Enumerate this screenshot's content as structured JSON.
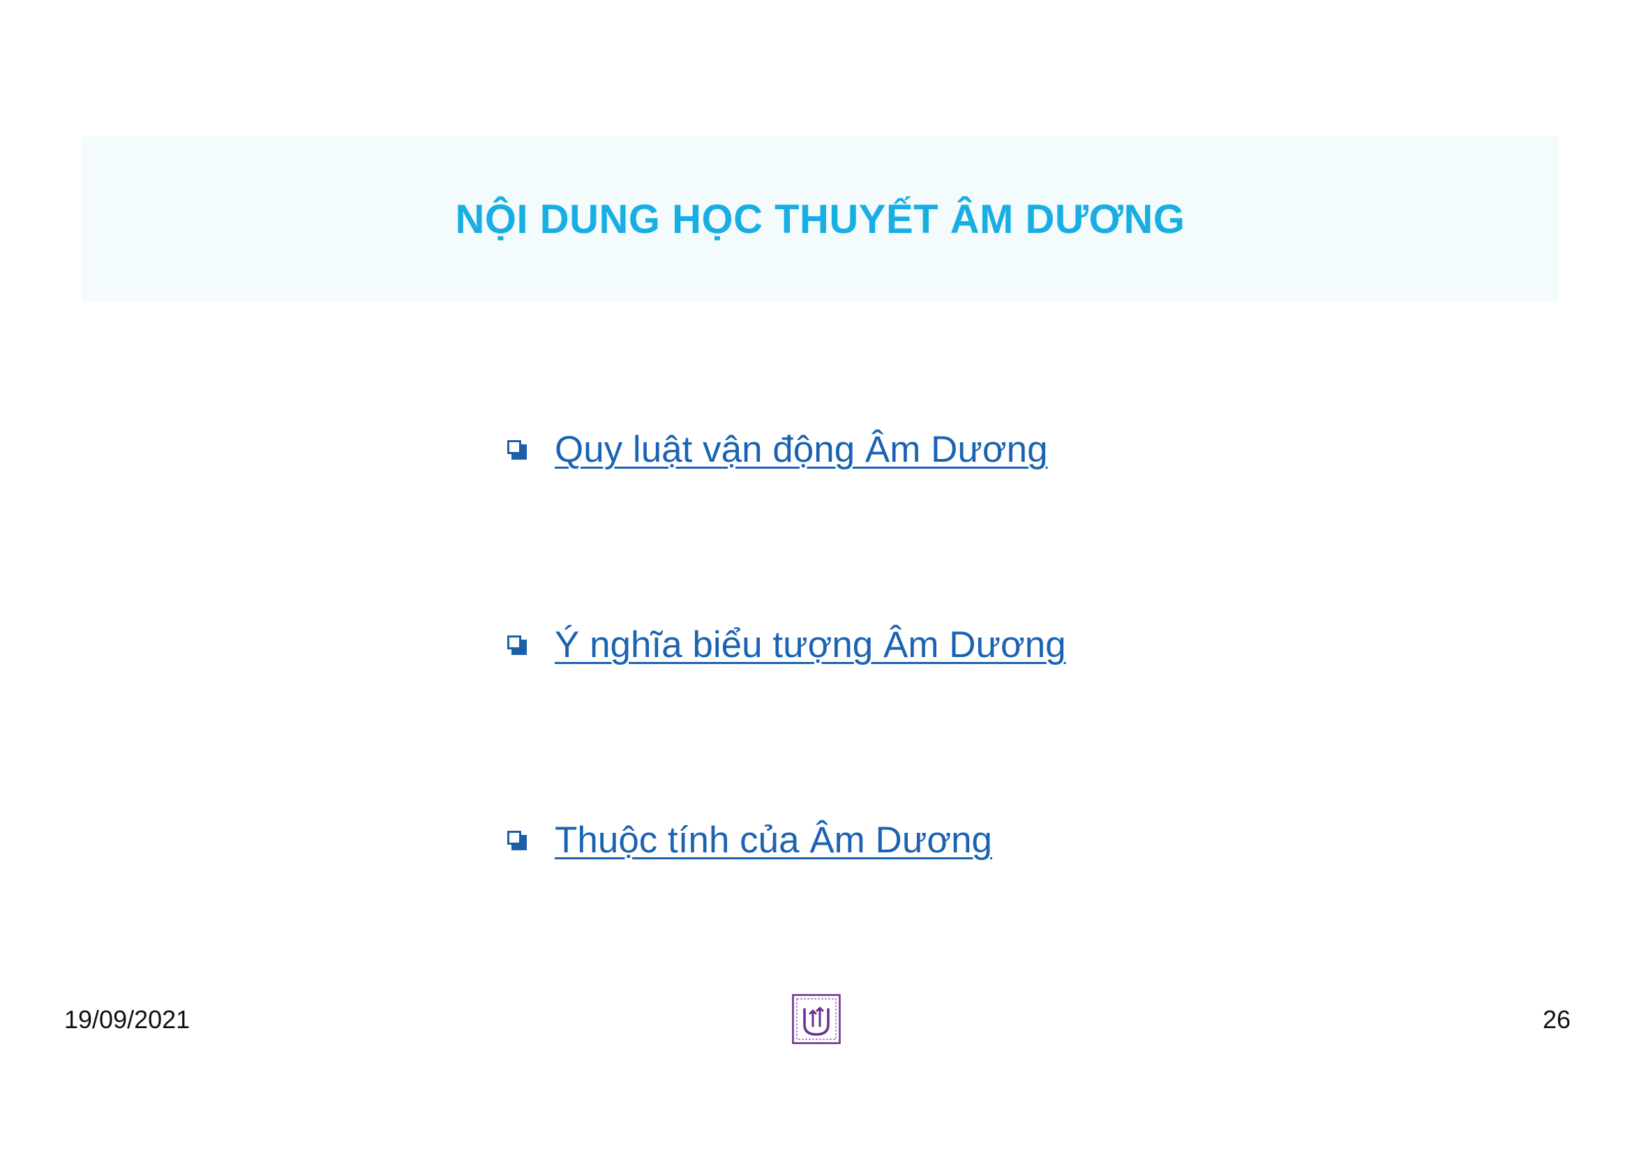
{
  "slide": {
    "title": "NỘI DUNG HỌC THUYẾT ÂM DƯƠNG",
    "items": [
      {
        "label": "Quy luật vận động Âm Dương",
        "icon": "checkbox-bullet-icon"
      },
      {
        "label": "Ý nghĩa biểu tượng Âm Dương",
        "icon": "checkbox-bullet-icon"
      },
      {
        "label": "Thuộc tính của Âm Dương",
        "icon": "checkbox-bullet-icon"
      }
    ],
    "footer": {
      "date": "19/09/2021",
      "page_number": "26",
      "logo_icon": "university-logo-icon"
    }
  },
  "colors": {
    "title": "#19aee3",
    "title_band": "#f3fbfc",
    "link": "#1b63b2",
    "bullet": "#1b5fa8",
    "logo": "#6a2c8f"
  }
}
